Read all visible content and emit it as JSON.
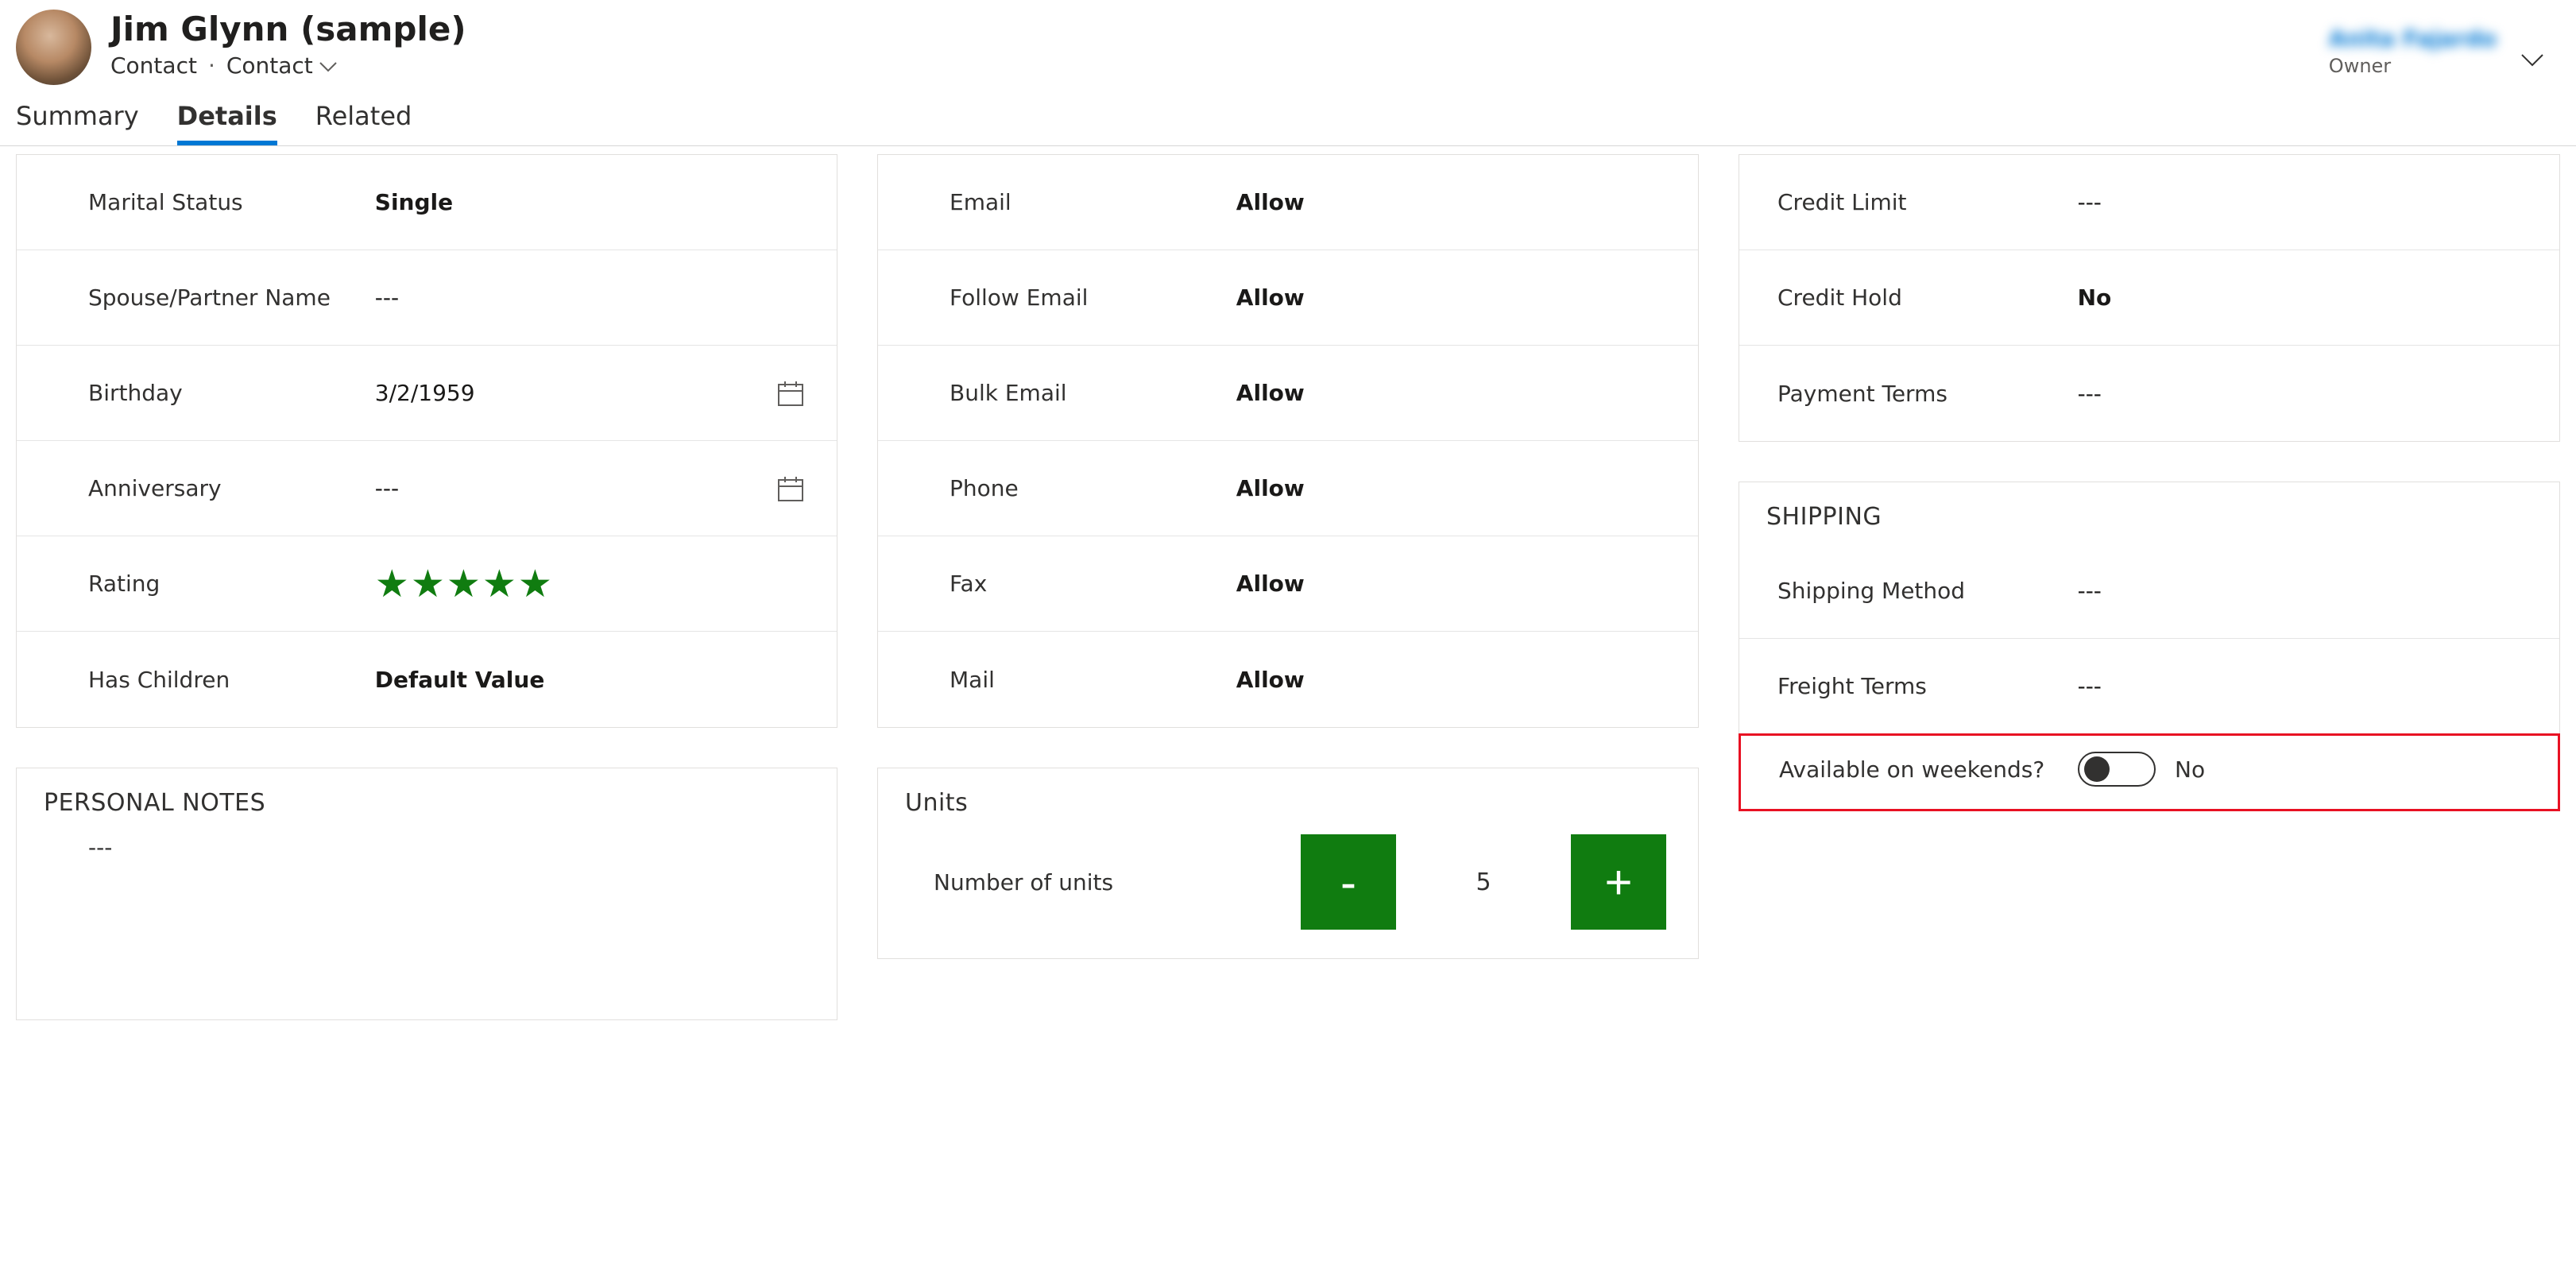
{
  "header": {
    "title": "Jim Glynn (sample)",
    "entity": "Contact",
    "form_name": "Contact",
    "owner_value": "Anita Fajardo",
    "owner_label": "Owner"
  },
  "tabs": {
    "summary": "Summary",
    "details": "Details",
    "related": "Related",
    "active": "details"
  },
  "personal": {
    "marital_status_label": "Marital Status",
    "marital_status_value": "Single",
    "spouse_label": "Spouse/Partner Name",
    "spouse_value": "---",
    "birthday_label": "Birthday",
    "birthday_value": "3/2/1959",
    "anniversary_label": "Anniversary",
    "anniversary_value": "---",
    "rating_label": "Rating",
    "rating_value": 5,
    "has_children_label": "Has Children",
    "has_children_value": "Default Value"
  },
  "notes": {
    "section_title": "PERSONAL NOTES",
    "value": "---"
  },
  "contact_prefs": {
    "email_label": "Email",
    "email_value": "Allow",
    "follow_email_label": "Follow Email",
    "follow_email_value": "Allow",
    "bulk_email_label": "Bulk Email",
    "bulk_email_value": "Allow",
    "phone_label": "Phone",
    "phone_value": "Allow",
    "fax_label": "Fax",
    "fax_value": "Allow",
    "mail_label": "Mail",
    "mail_value": "Allow"
  },
  "units": {
    "section_title": "Units",
    "label": "Number of units",
    "value": "5",
    "minus": "-",
    "plus": "+"
  },
  "billing": {
    "credit_limit_label": "Credit Limit",
    "credit_limit_value": "---",
    "credit_hold_label": "Credit Hold",
    "credit_hold_value": "No",
    "payment_terms_label": "Payment Terms",
    "payment_terms_value": "---"
  },
  "shipping": {
    "section_title": "SHIPPING",
    "method_label": "Shipping Method",
    "method_value": "---",
    "freight_label": "Freight Terms",
    "freight_value": "---",
    "weekends_label": "Available on weekends?",
    "weekends_value": "No"
  }
}
